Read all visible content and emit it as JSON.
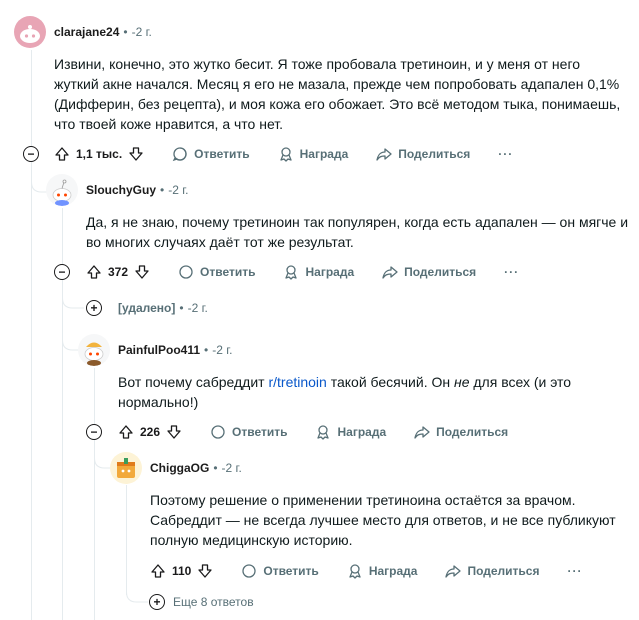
{
  "actions": {
    "reply": "Ответить",
    "award": "Награда",
    "share": "Поделиться",
    "more": "···"
  },
  "comments": [
    {
      "author": "clarajane24",
      "time": "-2 г.",
      "body_lines": [
        "Извини, конечно, это жутко бесит. Я тоже пробовала третиноин, и у меня от него",
        "жуткий акне начался. Месяц я его не мазала, прежде чем попробовать адапален 0,1%",
        "(Дифферин, без рецепта), и моя кожа его обожает. Это всё методом тыка, понимаешь,",
        "что твоей коже нравится, а что нет."
      ],
      "votes": "1,1 тыс."
    },
    {
      "author": "SlouchyGuy",
      "time": "-2 г.",
      "body_lines": [
        "Да, я не знаю, почему третиноин так популярен, когда есть адапален — он мягче и",
        "во многих случаях даёт тот же результат."
      ],
      "votes": "372"
    },
    {
      "author": "[удалено]",
      "time": "-2 г."
    },
    {
      "author": "PainfulPoo411",
      "time": "-2 г.",
      "body_before_link": "Вот почему сабреддит ",
      "body_link": "r/tretinoin",
      "body_after_link": " такой бесячий. Он ",
      "body_emph": "не",
      "body_after_emph": " для всех (и это",
      "body_line2": "нормально!)",
      "votes": "226"
    },
    {
      "author": "ChiggaOG",
      "time": "-2 г.",
      "body_lines": [
        "Поэтому решение о применении третиноина остаётся за врачом.",
        "Сабреддит — не всегда лучшее место для ответов, и не все публикуют",
        "полную медицинскую историю."
      ],
      "votes": "110"
    }
  ],
  "more_replies": "Еще 8 ответов",
  "colors": {
    "link": "#0a58ca",
    "muted": "#576f76",
    "thread": "#e5ebee",
    "avatar1": "#e8a5b5"
  }
}
